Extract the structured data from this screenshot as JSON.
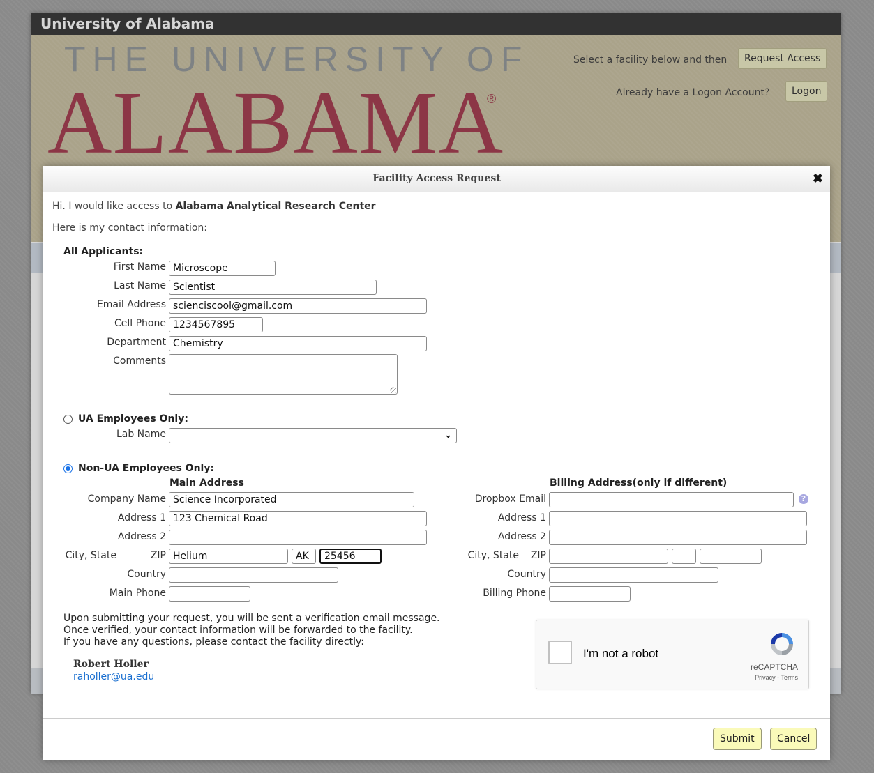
{
  "header": {
    "site_title": "University of Alabama",
    "logo_line1": "THE UNIVERSITY OF",
    "logo_line2": "ALABAMA",
    "logo_reg": "®",
    "select_text": "Select a facility below and then",
    "request_access_label": "Request Access",
    "logon_prompt": "Already have a Logon Account?",
    "logon_label": "Logon"
  },
  "dialog": {
    "title": "Facility Access Request",
    "close_glyph": "✖",
    "intro_prefix": "Hi. I would like access to ",
    "facility_name": "Alabama Analytical Research Center",
    "contact_intro": "Here is my contact information:"
  },
  "applicants": {
    "heading": "All Applicants:",
    "first_name_label": "First Name",
    "first_name_value": "Microscope",
    "last_name_label": "Last Name",
    "last_name_value": "Scientist",
    "email_label": "Email Address",
    "email_value": "scienciscool@gmail.com",
    "cell_label": "Cell Phone",
    "cell_value": "1234567895",
    "department_label": "Department",
    "department_value": "Chemistry",
    "comments_label": "Comments",
    "comments_value": ""
  },
  "ua_employees": {
    "heading": "UA Employees Only:",
    "selected": false,
    "lab_name_label": "Lab Name",
    "lab_name_value": ""
  },
  "non_ua": {
    "heading": "Non-UA Employees Only:",
    "selected": true,
    "main_address_heading": "Main Address",
    "billing_heading": "Billing Address(only if different)",
    "company_label": "Company Name",
    "company_value": "Science Incorporated",
    "address1_label": "Address 1",
    "address1_value": "123 Chemical Road",
    "address2_label": "Address 2",
    "address2_value": "",
    "city_state_label": "City, State",
    "zip_label": "ZIP",
    "city_value": "Helium",
    "state_value": "AK",
    "zip_value": "25456",
    "country_label": "Country",
    "country_value": "",
    "main_phone_label": "Main Phone",
    "main_phone_value": "",
    "dropbox_label": "Dropbox Email",
    "dropbox_value": "",
    "billing_address1_label": "Address 1",
    "billing_address1_value": "",
    "billing_address2_label": "Address 2",
    "billing_address2_value": "",
    "billing_city_state_label": "City, State",
    "billing_zip_label": "ZIP",
    "billing_city_value": "",
    "billing_state_value": "",
    "billing_zip_value": "",
    "billing_country_label": "Country",
    "billing_country_value": "",
    "billing_phone_label": "Billing Phone",
    "billing_phone_value": "",
    "help_glyph": "?"
  },
  "info": {
    "line1": "Upon submitting your request, you will be sent a verification email message.",
    "line2": "Once verified, your contact information will be forwarded to the facility.",
    "line3": "If you have any questions, please contact the facility directly:",
    "contact_name": "Robert Holler",
    "contact_email": "raholler@ua.edu"
  },
  "recaptcha": {
    "label": "I'm not a robot",
    "brand": "reCAPTCHA",
    "links": "Privacy - Terms"
  },
  "footer": {
    "submit_label": "Submit",
    "cancel_label": "Cancel"
  },
  "colors": {
    "banner": "#c5bb9a",
    "crimson": "#9c2a3f",
    "button_yellow": "#fafab9",
    "link_blue": "#1a6fd0",
    "radio_blue": "#1a73e8"
  }
}
